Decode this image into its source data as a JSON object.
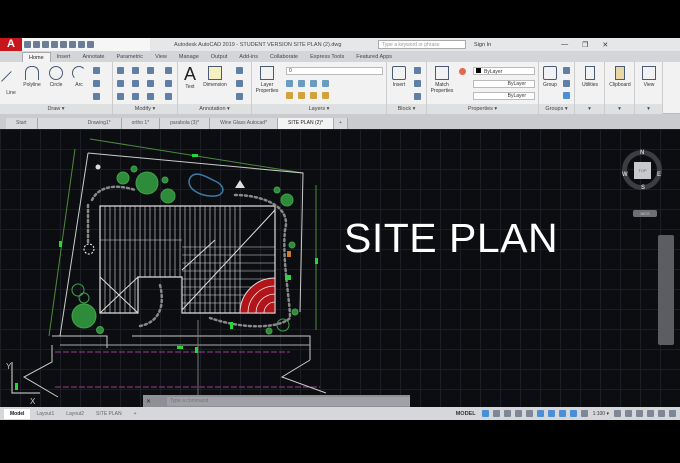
{
  "app": {
    "logo": "A",
    "title": "Autodesk AutoCAD 2019 - STUDENT VERSION   SITE PLAN (2).dwg",
    "search_placeholder": "Type a keyword or phrase",
    "signin": "Sign In",
    "min": "—",
    "max": "❐",
    "close": "✕"
  },
  "ribbon_tabs": [
    "Home",
    "Insert",
    "Annotate",
    "Parametric",
    "View",
    "Manage",
    "Output",
    "Add-ins",
    "Collaborate",
    "Express Tools",
    "Featured Apps"
  ],
  "panels": {
    "draw": {
      "label": "Draw ▾",
      "tools": [
        "Line",
        "Polyline",
        "Circle",
        "Arc"
      ]
    },
    "modify": {
      "label": "Modify ▾"
    },
    "annotation": {
      "label": "Annotation ▾",
      "tools": [
        "Text",
        "Dimension"
      ]
    },
    "layers": {
      "label": "Layers ▾",
      "tools": [
        "Layer Properties"
      ],
      "current_layer": "0"
    },
    "block": {
      "label": "Block ▾",
      "tools": [
        "Insert"
      ]
    },
    "properties": {
      "label": "Properties ▾",
      "tools": [
        "Match Properties"
      ],
      "color": "ByLayer",
      "linetype": "ByLayer",
      "lineweight": "ByLayer"
    },
    "groups": {
      "label": "Groups ▾",
      "tools": [
        "Group"
      ]
    },
    "utilities": {
      "label": "Utilities"
    },
    "clipboard": {
      "label": "Clipboard"
    },
    "view": {
      "label": "View"
    }
  },
  "file_tabs": [
    "Start",
    "Drawing1*",
    "ortho 1*",
    "parabola (3)*",
    "Wine Glass Autocad*",
    "SITE PLAN (2)*"
  ],
  "active_file_tab": "SITE PLAN (2)*",
  "new_tab": "+",
  "canvas": {
    "annotation": "SITE PLAN",
    "ucs_x": "X",
    "ucs_y": "Y"
  },
  "viewcube": {
    "n": "N",
    "s": "S",
    "e": "E",
    "w": "W",
    "top": "TOP",
    "wcs": "WCS"
  },
  "command": {
    "placeholder": "Type a command"
  },
  "layout_tabs": [
    "Model",
    "Layout1",
    "Layout2",
    "SITE PLAN"
  ],
  "status": {
    "mode": "MODEL",
    "scale": "1:100 ▾"
  },
  "colors": {
    "accent": "#c8161d",
    "canvas": "#0c0d11",
    "red_arc": "#b3141a",
    "tree": "#2e8b3a"
  }
}
